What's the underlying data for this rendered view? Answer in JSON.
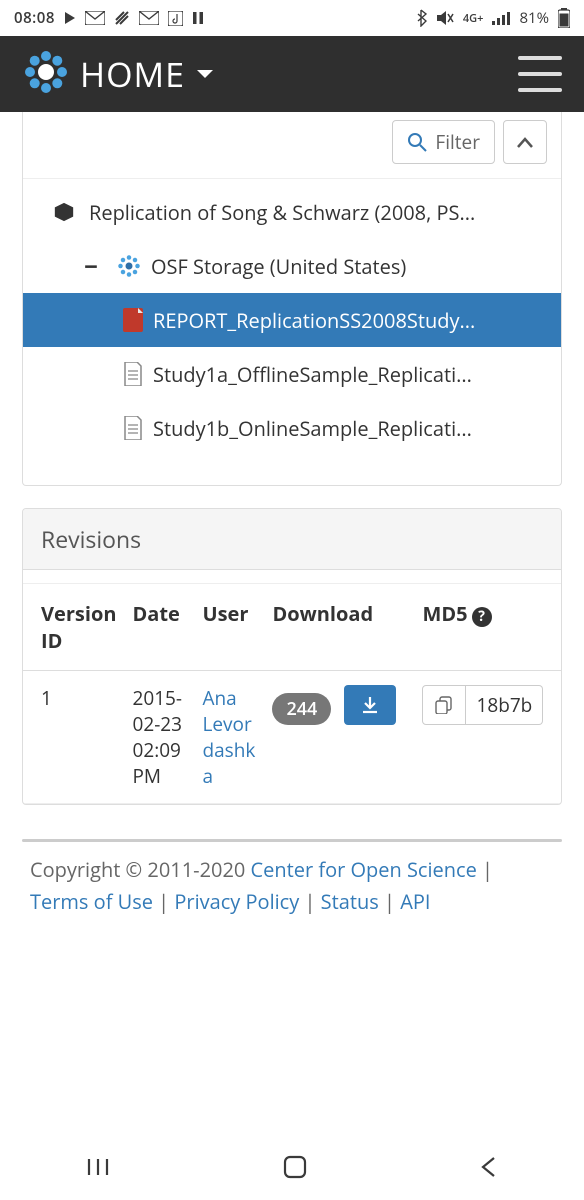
{
  "status": {
    "time": "08:08",
    "network": "4G+",
    "battery": "81%",
    "battery_level": 81
  },
  "nav": {
    "home_label": "HOME"
  },
  "filter": {
    "label": "Filter"
  },
  "tree": {
    "project": "Replication of Song & Schwarz (2008, PS...",
    "storage": "OSF Storage (United States)",
    "files": [
      "REPORT_ReplicationSS2008Study...",
      "Study1a_OfflineSample_Replicati...",
      "Study1b_OnlineSample_Replicati..."
    ]
  },
  "revisions": {
    "title": "Revisions",
    "cols": {
      "version": "Version ID",
      "date": "Date",
      "user": "User",
      "download": "Download",
      "md5": "MD5"
    },
    "rows": [
      {
        "version": "1",
        "date": "2015-02-23 02:09 PM",
        "user": "Ana Levordashka",
        "count": "244",
        "md5": "18b7b"
      }
    ]
  },
  "footer": {
    "copyright": "Copyright © 2011-2020 ",
    "cos": "Center for Open Science",
    "sep": " | ",
    "terms": "Terms of Use",
    "privacy": "Privacy Policy",
    "status": "Status",
    "api": "API"
  }
}
